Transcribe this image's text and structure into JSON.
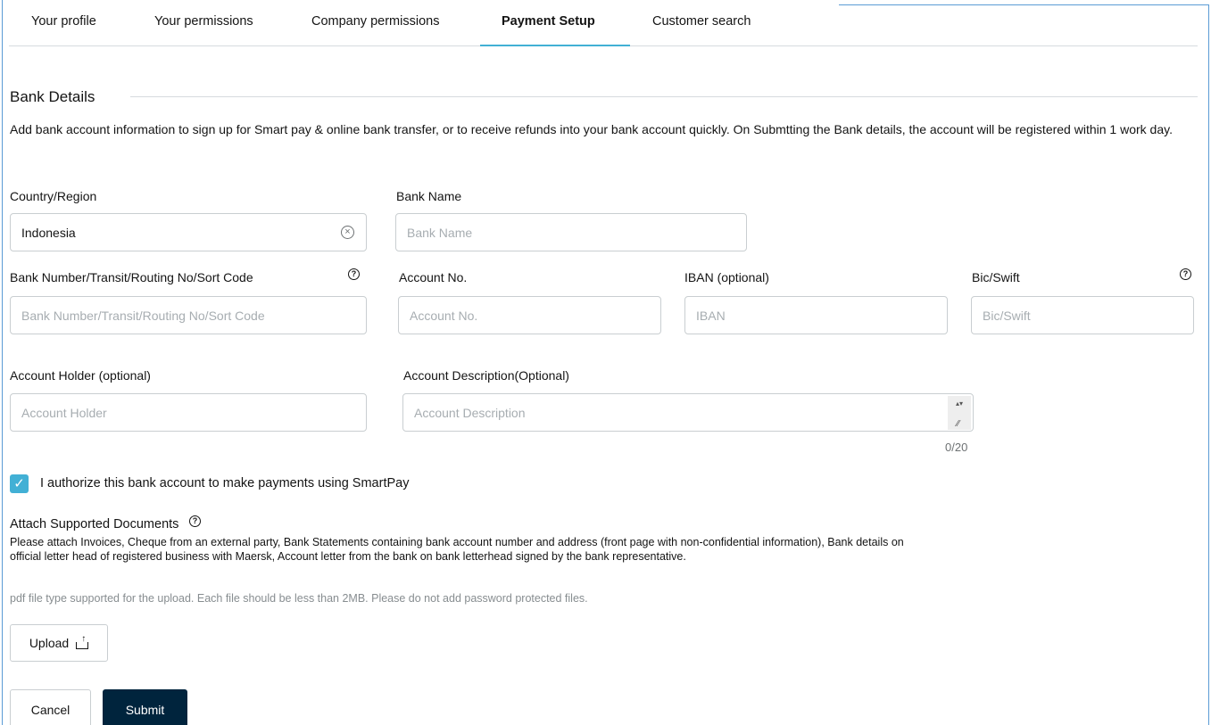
{
  "tabs": [
    {
      "label": "Your profile"
    },
    {
      "label": "Your permissions"
    },
    {
      "label": "Company permissions"
    },
    {
      "label": "Payment Setup",
      "active": true
    },
    {
      "label": "Customer search"
    }
  ],
  "section": {
    "title": "Bank Details",
    "intro": "Add bank account information to sign up for Smart pay & online bank transfer, or to receive refunds into your bank account quickly. On Submtting the Bank details, the account will be registered within 1 work day."
  },
  "fields": {
    "country": {
      "label": "Country/Region",
      "value": "Indonesia"
    },
    "bank_name": {
      "label": "Bank Name",
      "placeholder": "Bank Name"
    },
    "bank_number": {
      "label": "Bank Number/Transit/Routing No/Sort Code",
      "placeholder": "Bank Number/Transit/Routing No/Sort Code"
    },
    "account_no": {
      "label": "Account No.",
      "placeholder": "Account No."
    },
    "iban": {
      "label": "IBAN (optional)",
      "placeholder": "IBAN"
    },
    "bic": {
      "label": "Bic/Swift",
      "placeholder": "Bic/Swift"
    },
    "holder": {
      "label": "Account Holder (optional)",
      "placeholder": "Account Holder"
    },
    "description": {
      "label": "Account Description(Optional)",
      "placeholder": "Account Description",
      "counter": "0/20"
    }
  },
  "authorize": {
    "label": "I authorize this bank account to make payments using SmartPay",
    "checked": true
  },
  "attach": {
    "title": "Attach Supported Documents",
    "description": "Please attach Invoices, Cheque from an external party, Bank Statements containing bank account number and address (front page with non-confidential information), Bank details on official letter head of registered business with Maersk, Account letter from the bank on bank letterhead signed by the bank representative.",
    "hint": "pdf file type supported for the upload. Each file should be less than 2MB. Please do not add password protected files."
  },
  "buttons": {
    "upload": "Upload",
    "cancel": "Cancel",
    "submit": "Submit"
  },
  "icons": {
    "help": "?",
    "clear": "×",
    "check": "✓"
  },
  "colors": {
    "accent": "#42b0d5",
    "primary": "#00243d",
    "border": "#c9ced1",
    "placeholder": "#a7adb1"
  }
}
